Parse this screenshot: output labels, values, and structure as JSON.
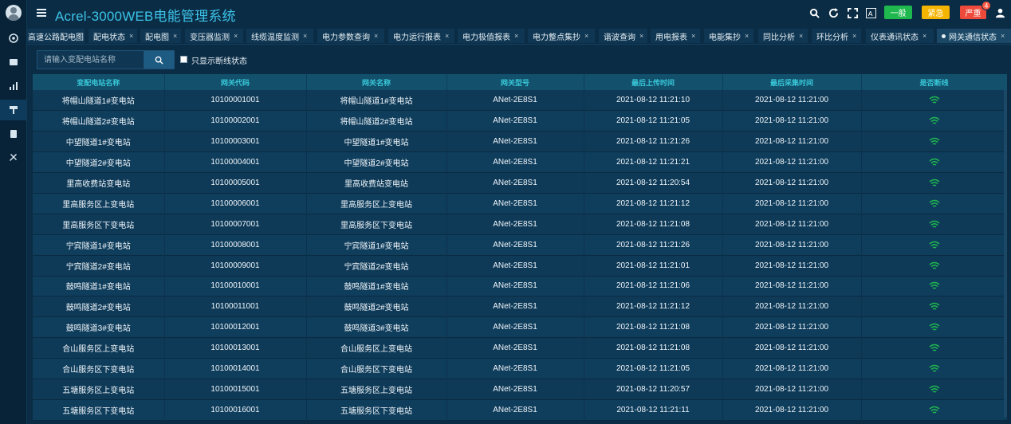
{
  "app": {
    "title": "Acrel-3000WEB电能管理系统"
  },
  "rail": {
    "items": [
      {
        "icon": "dashboard-icon"
      },
      {
        "icon": "folder-icon"
      },
      {
        "icon": "bar-chart-icon"
      },
      {
        "icon": "tower-icon"
      },
      {
        "icon": "document-icon"
      },
      {
        "icon": "tools-icon"
      }
    ]
  },
  "header": {
    "icons": [
      "search-icon",
      "refresh-icon",
      "fullscreen-icon",
      "font-size-icon"
    ],
    "alarm_general": "一般",
    "alarm_urgent": "紧急",
    "alarm_severe": "严重",
    "alarm_severe_count": "4",
    "colors": {
      "general": "#1fb84f",
      "urgent": "#f5b400",
      "severe": "#ee4a3b",
      "title": "#3cc3e8"
    }
  },
  "tabs": [
    {
      "label": "高速公路配电图",
      "closable": false
    },
    {
      "label": "配电状态",
      "closable": true
    },
    {
      "label": "配电图",
      "closable": true
    },
    {
      "label": "变压器监测",
      "closable": true
    },
    {
      "label": "线缆温度监测",
      "closable": true
    },
    {
      "label": "电力参数查询",
      "closable": true
    },
    {
      "label": "电力运行报表",
      "closable": true
    },
    {
      "label": "电力极值报表",
      "closable": true
    },
    {
      "label": "电力整点集抄",
      "closable": true
    },
    {
      "label": "谐波查询",
      "closable": true
    },
    {
      "label": "用电报表",
      "closable": true
    },
    {
      "label": "电能集抄",
      "closable": true
    },
    {
      "label": "同比分析",
      "closable": true
    },
    {
      "label": "环比分析",
      "closable": true
    },
    {
      "label": "仪表通讯状态",
      "closable": true
    },
    {
      "label": "网关通信状态",
      "closable": true,
      "active": true
    }
  ],
  "toolbar": {
    "search_placeholder": "请输入变配电站名称",
    "checkbox_label": "只显示断线状态",
    "checkbox_checked": false
  },
  "table": {
    "headers": [
      "变配电站名称",
      "网关代码",
      "网关名称",
      "网关型号",
      "最后上传时间",
      "最后采集时间",
      "是否断线"
    ],
    "rows": [
      [
        "将帽山隧道1#变电站",
        "10100001001",
        "将帽山隧道1#变电站",
        "ANet-2E8S1",
        "2021-08-12 11:21:10",
        "2021-08-12 11:21:00",
        "online"
      ],
      [
        "将帽山隧道2#变电站",
        "10100002001",
        "将帽山隧道2#变电站",
        "ANet-2E8S1",
        "2021-08-12 11:21:05",
        "2021-08-12 11:21:00",
        "online"
      ],
      [
        "中望隧道1#变电站",
        "10100003001",
        "中望隧道1#变电站",
        "ANet-2E8S1",
        "2021-08-12 11:21:26",
        "2021-08-12 11:21:00",
        "online"
      ],
      [
        "中望隧道2#变电站",
        "10100004001",
        "中望隧道2#变电站",
        "ANet-2E8S1",
        "2021-08-12 11:21:21",
        "2021-08-12 11:21:00",
        "online"
      ],
      [
        "里高收费站变电站",
        "10100005001",
        "里高收费站变电站",
        "ANet-2E8S1",
        "2021-08-12 11:20:54",
        "2021-08-12 11:21:00",
        "online"
      ],
      [
        "里高服务区上变电站",
        "10100006001",
        "里高服务区上变电站",
        "ANet-2E8S1",
        "2021-08-12 11:21:12",
        "2021-08-12 11:21:00",
        "online"
      ],
      [
        "里高服务区下变电站",
        "10100007001",
        "里高服务区下变电站",
        "ANet-2E8S1",
        "2021-08-12 11:21:08",
        "2021-08-12 11:21:00",
        "online"
      ],
      [
        "宁宾隧道1#变电站",
        "10100008001",
        "宁宾隧道1#变电站",
        "ANet-2E8S1",
        "2021-08-12 11:21:26",
        "2021-08-12 11:21:00",
        "online"
      ],
      [
        "宁宾隧道2#变电站",
        "10100009001",
        "宁宾隧道2#变电站",
        "ANet-2E8S1",
        "2021-08-12 11:21:01",
        "2021-08-12 11:21:00",
        "online"
      ],
      [
        "鼓鸣隧道1#变电站",
        "10100010001",
        "鼓鸣隧道1#变电站",
        "ANet-2E8S1",
        "2021-08-12 11:21:06",
        "2021-08-12 11:21:00",
        "online"
      ],
      [
        "鼓鸣隧道2#变电站",
        "10100011001",
        "鼓鸣隧道2#变电站",
        "ANet-2E8S1",
        "2021-08-12 11:21:12",
        "2021-08-12 11:21:00",
        "online"
      ],
      [
        "鼓鸣隧道3#变电站",
        "10100012001",
        "鼓鸣隧道3#变电站",
        "ANet-2E8S1",
        "2021-08-12 11:21:08",
        "2021-08-12 11:21:00",
        "online"
      ],
      [
        "合山服务区上变电站",
        "10100013001",
        "合山服务区上变电站",
        "ANet-2E8S1",
        "2021-08-12 11:21:08",
        "2021-08-12 11:21:00",
        "online"
      ],
      [
        "合山服务区下变电站",
        "10100014001",
        "合山服务区下变电站",
        "ANet-2E8S1",
        "2021-08-12 11:21:05",
        "2021-08-12 11:21:00",
        "online"
      ],
      [
        "五塘服务区上变电站",
        "10100015001",
        "五塘服务区上变电站",
        "ANet-2E8S1",
        "2021-08-12 11:20:57",
        "2021-08-12 11:21:00",
        "online"
      ],
      [
        "五塘服务区下变电站",
        "10100016001",
        "五塘服务区下变电站",
        "ANet-2E8S1",
        "2021-08-12 11:21:11",
        "2021-08-12 11:21:00",
        "online"
      ]
    ],
    "status_color": "#1fb84f"
  }
}
